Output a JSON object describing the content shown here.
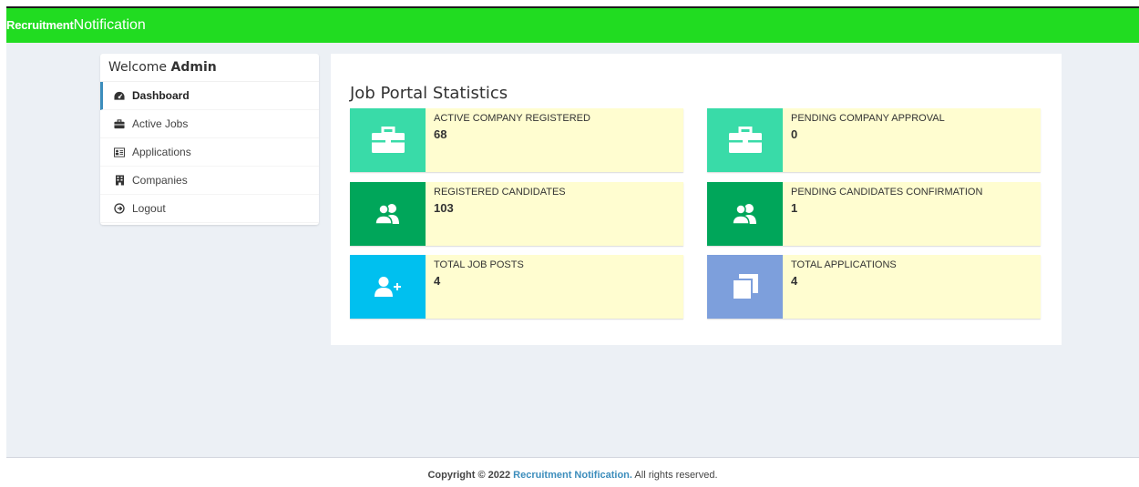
{
  "app": {
    "brand_bold": "Recruitment",
    "brand_rest": "Notification"
  },
  "sidebar": {
    "welcome_prefix": "Welcome",
    "welcome_user": "Admin",
    "items": [
      {
        "label": "Dashboard",
        "icon": "dashboard-icon",
        "active": true
      },
      {
        "label": "Active Jobs",
        "icon": "briefcase-icon",
        "active": false
      },
      {
        "label": "Applications",
        "icon": "id-card-icon",
        "active": false
      },
      {
        "label": "Companies",
        "icon": "building-icon",
        "active": false
      },
      {
        "label": "Logout",
        "icon": "logout-icon",
        "active": false
      }
    ]
  },
  "main": {
    "title": "Job Portal Statistics",
    "stats": [
      {
        "label": "ACTIVE COMPANY REGISTERED",
        "value": "68",
        "icon": "briefcase-icon",
        "color": "#39dba8"
      },
      {
        "label": "PENDING COMPANY APPROVAL",
        "value": "0",
        "icon": "briefcase-icon",
        "color": "#39dba8"
      },
      {
        "label": "REGISTERED CANDIDATES",
        "value": "103",
        "icon": "users-icon",
        "color": "#00a65a"
      },
      {
        "label": "PENDING CANDIDATES CONFIRMATION",
        "value": "1",
        "icon": "users-icon",
        "color": "#00a65a"
      },
      {
        "label": "TOTAL JOB POSTS",
        "value": "4",
        "icon": "user-plus-icon",
        "color": "#00c0ef"
      },
      {
        "label": "TOTAL APPLICATIONS",
        "value": "4",
        "icon": "clone-icon",
        "color": "#7d9fdc"
      }
    ]
  },
  "footer": {
    "copyright": "Copyright © 2022",
    "brand": "Recruitment Notification.",
    "rights": "All rights reserved."
  }
}
